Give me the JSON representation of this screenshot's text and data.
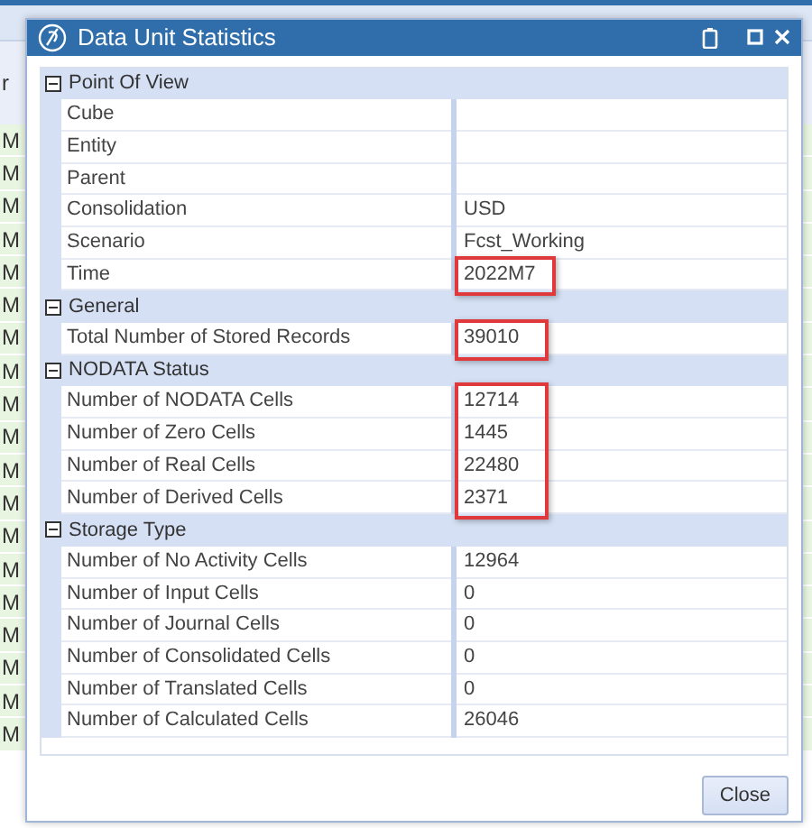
{
  "background": {
    "header_text": "r",
    "row_labels": [
      "M",
      "M",
      "M",
      "M",
      "M",
      "M",
      "M",
      "M",
      "M",
      "M",
      "M",
      "M",
      "M",
      "M",
      "M",
      "M",
      "M",
      "M",
      "M"
    ]
  },
  "dialog": {
    "title": "Data Unit Statistics",
    "groups": [
      {
        "title": "Point Of View",
        "expanded": true,
        "rows": [
          {
            "label": "Cube"
          },
          {
            "label": "Entity"
          },
          {
            "label": "Parent"
          },
          {
            "label": "Consolidation",
            "value": "USD"
          },
          {
            "label": "Scenario",
            "value": "Fcst_Working"
          },
          {
            "label": "Time",
            "value": "2022M7",
            "highlighted": true
          }
        ]
      },
      {
        "title": "General",
        "expanded": true,
        "rows": [
          {
            "label": "Total Number of Stored Records",
            "value": "39010",
            "highlighted": true
          }
        ]
      },
      {
        "title": "NODATA Status",
        "expanded": true,
        "rows": [
          {
            "label": "Number of NODATA Cells",
            "value": "12714",
            "highlighted": true
          },
          {
            "label": "Number of Zero Cells",
            "value": "1445",
            "highlighted": true
          },
          {
            "label": "Number of Real Cells",
            "value": "22480",
            "highlighted": true
          },
          {
            "label": "Number of Derived Cells",
            "value": "2371",
            "highlighted": true
          }
        ]
      },
      {
        "title": "Storage Type",
        "expanded": true,
        "rows": [
          {
            "label": "Number of No Activity Cells",
            "value": "12964"
          },
          {
            "label": "Number of Input Cells",
            "value": "0"
          },
          {
            "label": "Number of Journal Cells",
            "value": "0"
          },
          {
            "label": "Number of Consolidated Cells",
            "value": "0"
          },
          {
            "label": "Number of Translated Cells",
            "value": "0"
          },
          {
            "label": "Number of Calculated Cells",
            "value": "26046"
          }
        ]
      }
    ],
    "close_button": "Close"
  }
}
